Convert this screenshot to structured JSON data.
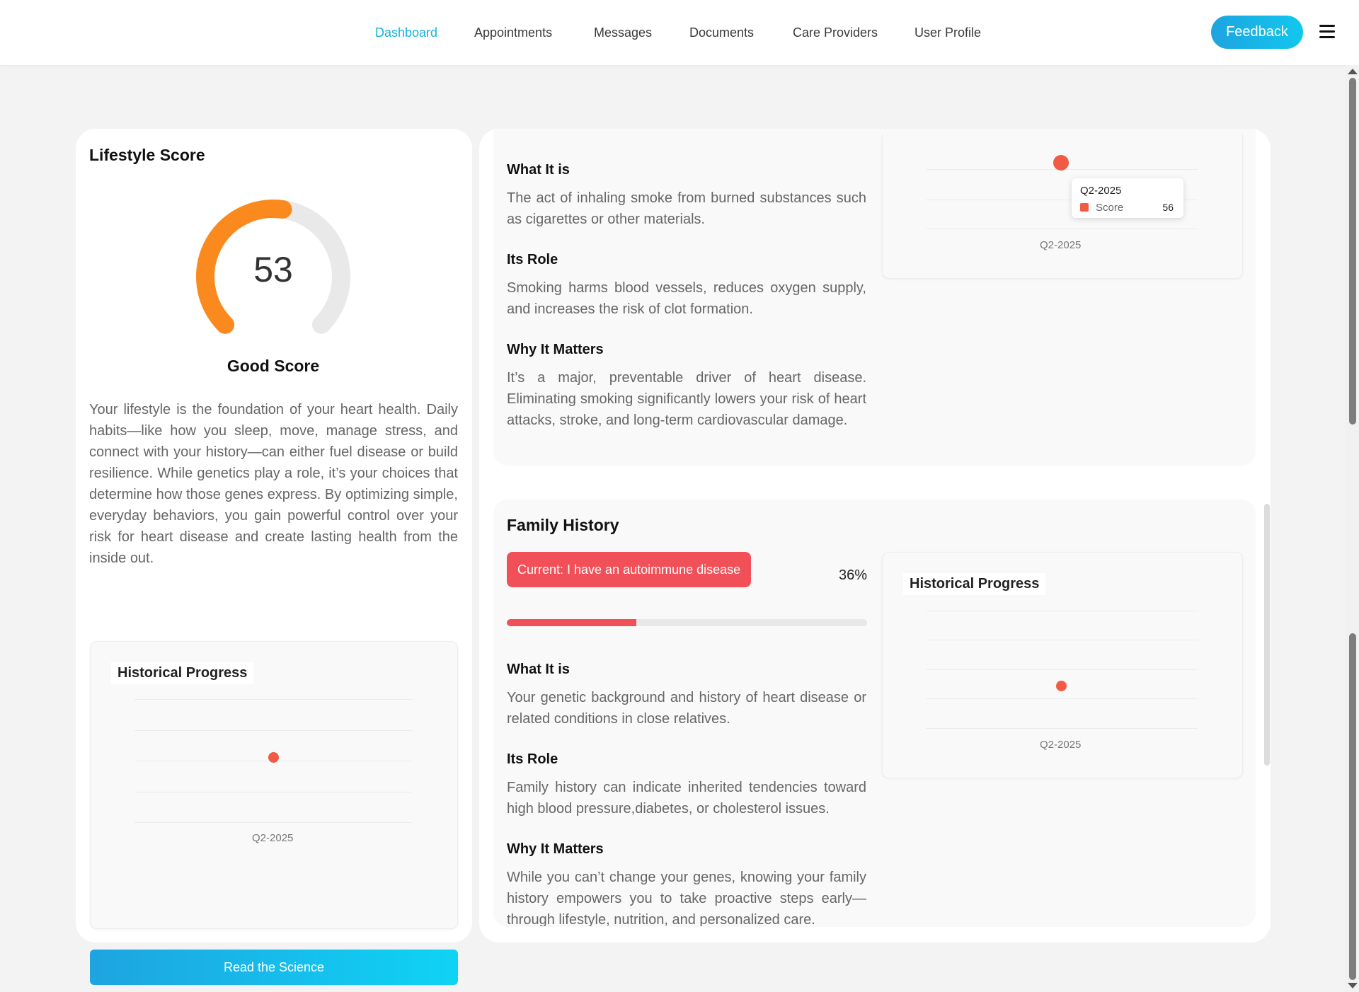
{
  "nav": {
    "items": [
      {
        "label": "Dashboard",
        "active": true
      },
      {
        "label": "Appointments",
        "active": false
      },
      {
        "label": "Messages",
        "active": false
      },
      {
        "label": "Documents",
        "active": false
      },
      {
        "label": "Care Providers",
        "active": false
      },
      {
        "label": "User Profile",
        "active": false
      }
    ],
    "feedback_label": "Feedback",
    "menu_icon": "hamburger-menu-icon",
    "accent_color": "#12b3e0"
  },
  "lifestyle": {
    "title": "Lifestyle Score",
    "score": "53",
    "score_fraction": 0.53,
    "score_label": "Good Score",
    "gauge_color": "#fa8a1e",
    "description": "Your lifestyle is the foundation of your heart health. Daily habits—like how you sleep, move, manage stress, and connect with your history—can either fuel disease or build resilience. While genetics play a role, it’s your choices that determine how those genes express. By optimizing simple, everyday behaviors, you gain powerful control over your risk for heart disease and create lasting health from the inside out.",
    "historical": {
      "title": "Historical Progress",
      "x_label": "Q2-2025"
    },
    "read_science_label": "Read the Science"
  },
  "smoking": {
    "what_heading": "What It is",
    "what_text": "The act of inhaling smoke from burned substances such as cigarettes or other materials.",
    "role_heading": "Its Role",
    "role_text": "Smoking harms blood vessels, reduces oxygen supply, and increases the risk of clot formation.",
    "why_heading": "Why It Matters",
    "why_text": "It’s a major, preventable driver of heart disease. Eliminating smoking significantly lowers your risk of heart attacks, stroke, and long-term cardiovascular damage.",
    "chart": {
      "x_label": "Q2-2025",
      "tooltip": {
        "date": "Q2-2025",
        "series": "Score",
        "value": "56"
      }
    }
  },
  "family_history": {
    "title": "Family History",
    "current_badge": "Current: I have an autoimmune disease",
    "percent_label": "36%",
    "percent_value": 0.36,
    "bar_color": "#f25058",
    "what_heading": "What It is",
    "what_text": "Your genetic background and history of heart disease or related conditions in close relatives.",
    "role_heading": "Its Role",
    "role_text": "Family history can indicate inherited tendencies toward high blood pressure,diabetes, or cholesterol issues.",
    "why_heading": "Why It Matters",
    "why_text": "While you can’t change your genes, knowing your family history empowers you to take proactive steps early—through lifestyle, nutrition, and personalized care.",
    "historical": {
      "title": "Historical Progress",
      "x_label": "Q2-2025"
    }
  }
}
